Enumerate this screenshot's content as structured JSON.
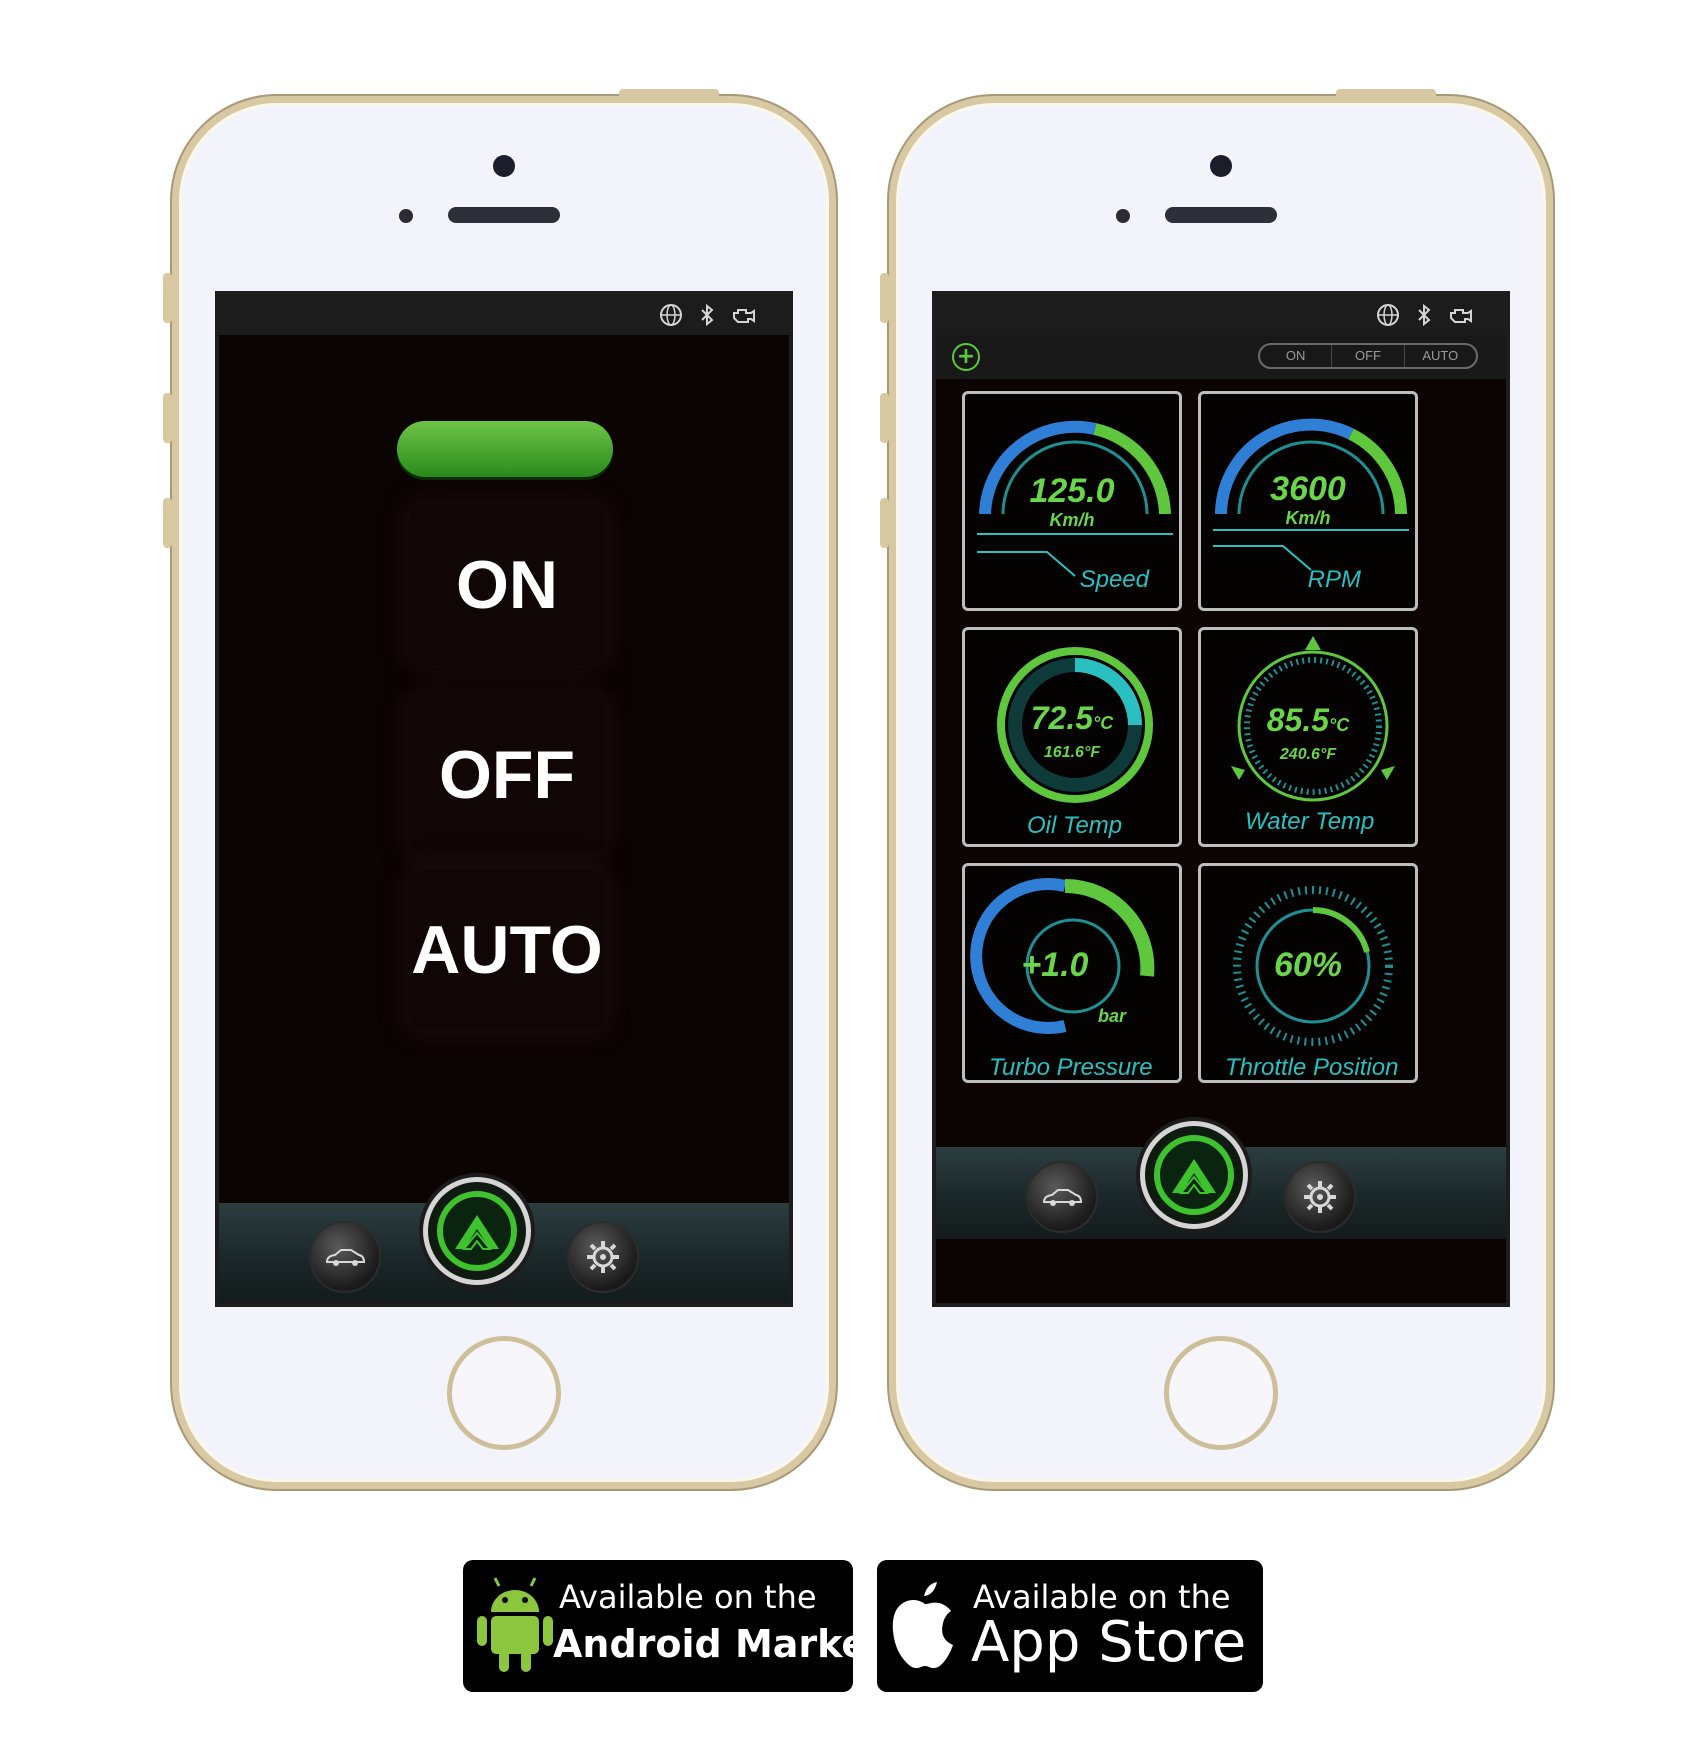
{
  "phone_left": {
    "status_icons": [
      "globe-icon",
      "bluetooth-icon",
      "engine-icon"
    ],
    "modes": [
      "ON",
      "OFF",
      "AUTO"
    ],
    "nav": [
      "car-icon",
      "logo-icon",
      "settings-gear-icon"
    ]
  },
  "phone_right": {
    "status_icons": [
      "globe-icon",
      "bluetooth-icon",
      "engine-icon"
    ],
    "segmented": [
      "ON",
      "OFF",
      "AUTO"
    ],
    "gauges": [
      {
        "value": "125.0",
        "unit": "Km/h",
        "label": "Speed"
      },
      {
        "value": "3600",
        "unit": "Km/h",
        "label": "RPM"
      },
      {
        "value": "72.5",
        "unit_c": "°C",
        "sub": "161.6",
        "sub_unit": "°F",
        "label": "Oil Temp"
      },
      {
        "value": "85.5",
        "unit_c": "°C",
        "sub": "240.6",
        "sub_unit": "°F",
        "label": "Water Temp"
      },
      {
        "value": "+1.0",
        "unit": "bar",
        "label": "Turbo Pressure"
      },
      {
        "value": "60%",
        "label": "Throttle Position"
      }
    ],
    "nav": [
      "car-icon",
      "logo-icon",
      "settings-gear-icon"
    ]
  },
  "badges": {
    "android": {
      "line1": "Available on the",
      "line2": "Android Market"
    },
    "apple": {
      "line1": "Available on the",
      "line2": "App Store"
    }
  },
  "colors": {
    "accent_green": "#5ec73d",
    "accent_blue": "#2f7fd6",
    "accent_cyan": "#2ac0c2",
    "frame_gold": "#d8c9a3"
  }
}
